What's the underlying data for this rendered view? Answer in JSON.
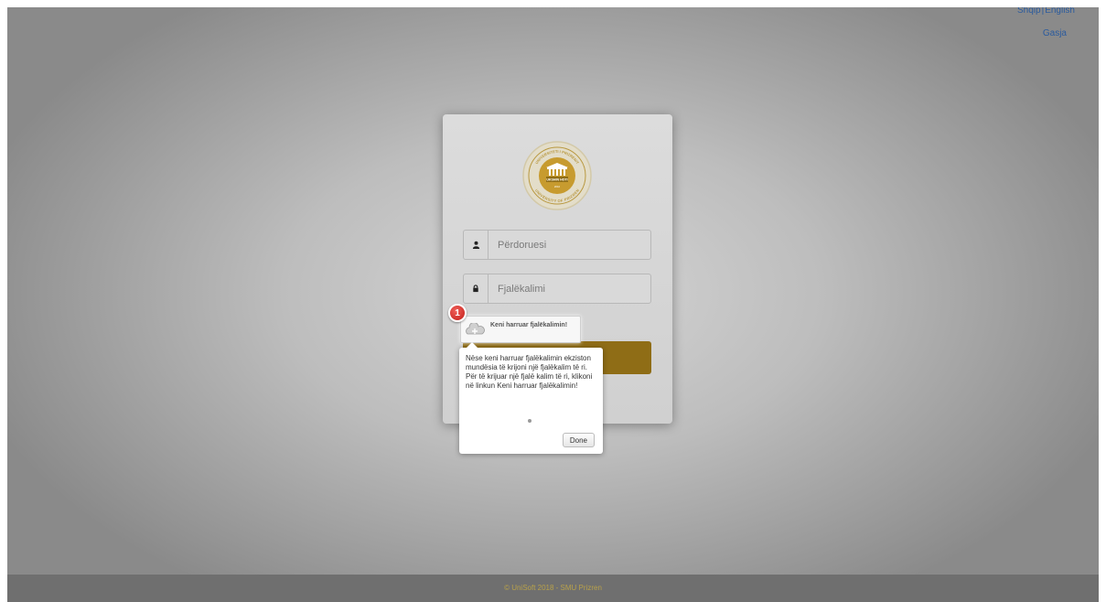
{
  "topbar": {
    "lang_sq": "Shqip",
    "separator": "|",
    "lang_en": "English",
    "help": "Gasja"
  },
  "login": {
    "logo_icon": "university-seal-logo",
    "logo_title": "UNIVERSITETI I PRIZRENIT",
    "logo_name": "UKSHIN HOTI",
    "logo_year": "2010",
    "logo_subtitle": "UNIVERSITY OF PRIZREN",
    "username_placeholder": "Përdoruesi",
    "password_placeholder": "Fjalëkalimi",
    "username_icon": "user-icon",
    "password_icon": "lock-icon",
    "button_label": ""
  },
  "tour": {
    "step": "1",
    "target_label": "Keni harruar fjalëkalimin!",
    "body": "Nëse keni harruar fjalëkalimin ekziston mundësia të krijoni një fjalëkalim të ri. Për të krijuar një fjalë kalim të ri, klikoni në linkun Keni harruar fjalëkalimin!",
    "done_label": "Done"
  },
  "footer": {
    "text": "© UniSoft 2018 - SMU Prizren"
  },
  "colors": {
    "accent_gold": "#8f6d16",
    "badge_red": "#c21d18",
    "link_blue": "#2b5b9e"
  }
}
